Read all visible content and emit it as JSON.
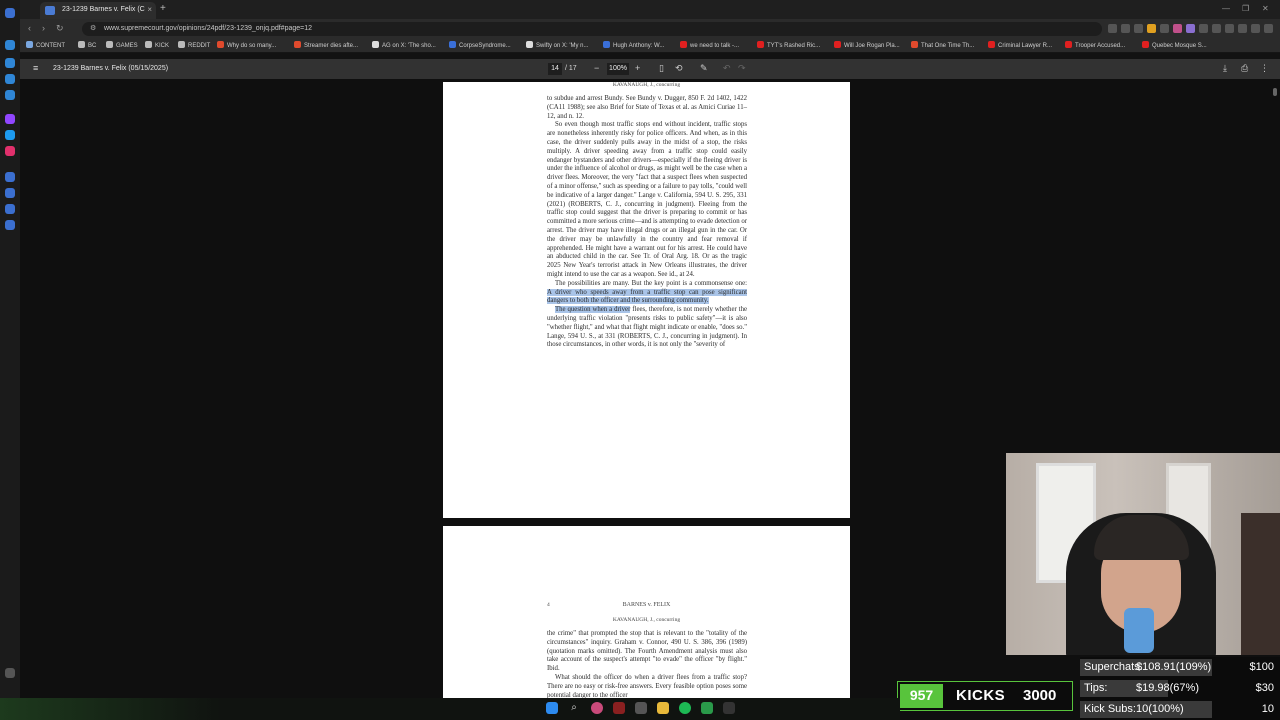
{
  "browser": {
    "tab_title": "23-1239 Barnes v. Felix (C",
    "tab_close": "×",
    "new_tab": "+",
    "url": "www.supremecourt.gov/opinions/24pdf/23-1239_onjq.pdf#page=12",
    "bookmarks": [
      {
        "label": "CONTENT",
        "color": "#7aa7e0"
      },
      {
        "label": "BC",
        "color": "#bbbbbb"
      },
      {
        "label": "GAMES",
        "color": "#bbbbbb"
      },
      {
        "label": "KICK",
        "color": "#bbbbbb"
      },
      {
        "label": "REDDIT",
        "color": "#bbbbbb"
      },
      {
        "label": "Why do so many...",
        "color": "#e04a2d"
      },
      {
        "label": "Streamer dies afte...",
        "color": "#e04a2d"
      },
      {
        "label": "AG on X: 'The sho...",
        "color": "#dddddd"
      },
      {
        "label": "CorpseSyndrome...",
        "color": "#3a6fd8"
      },
      {
        "label": "Swifty on X: 'My n...",
        "color": "#dddddd"
      },
      {
        "label": "Hugh Anthony: W...",
        "color": "#3a6fd8"
      },
      {
        "label": "we need to talk -...",
        "color": "#e02020"
      },
      {
        "label": "TYT's Rashed Ric...",
        "color": "#e02020"
      },
      {
        "label": "Will Joe Rogan Pla...",
        "color": "#e02020"
      },
      {
        "label": "That One Time Th...",
        "color": "#e04a2d"
      },
      {
        "label": "Criminal Lawyer R...",
        "color": "#e02020"
      },
      {
        "label": "Trooper Accused...",
        "color": "#e02020"
      },
      {
        "label": "Quebec Mosque S...",
        "color": "#e02020"
      }
    ]
  },
  "pdf": {
    "title": "23-1239 Barnes v. Felix (05/15/2025)",
    "current_page": "14",
    "total_pages": "/ 17",
    "zoom": "100%",
    "zoom_out": "−",
    "zoom_in": "+",
    "page1": {
      "running_head": "KAVANAUGH, J., concurring",
      "paragraphs": [
        {
          "pre": "to subdue and arrest Bundy.  See Bundy v. Dugger, 850 F. 2d 1402, 1422 (CA11 1988); see also Brief for State of Texas et al. as Amici Curiae 11–12, and n. 12.",
          "hl": "",
          "post": ""
        },
        {
          "pre": "So even though most traffic stops end without incident, traffic stops are nonetheless inherently risky for police officers.  And when, as in this case, the driver suddenly pulls away in the midst of a stop, the risks multiply.  A driver speeding away from a traffic stop could easily endanger bystanders and other drivers—especially if the fleeing driver is under the influence of alcohol or drugs, as might well be the case when a driver flees.  Moreover, the very \"fact that a suspect flees when suspected of a minor offense,\" such as speeding or a failure to pay tolls, \"could well be indicative of a larger danger.\"  Lange v. California, 594 U. S. 295, 331 (2021) (ROBERTS, C. J., concurring in judgment).  Fleeing from the traffic stop could suggest that the driver is preparing to commit or has committed a more serious crime—and is attempting to evade detection or arrest.  The driver may have illegal drugs or an illegal gun in the car.  Or the driver may be unlawfully in the country and fear removal if apprehended.  He might have a warrant out for his arrest.  He could have an abducted child in the car.  See Tr. of Oral Arg. 18.  Or as the tragic 2025 New Year's terrorist attack in New Orleans illustrates, the driver might intend to use the car as a weapon.  See id., at 24.",
          "hl": "",
          "post": ""
        },
        {
          "pre": "The possibilities are many.  But the key point is a commonsense one: ",
          "hl": "A driver who speeds away from a traffic stop can pose significant dangers to both the officer and the surrounding community.",
          "post": ""
        },
        {
          "pre": "",
          "hl": "The question when a driver",
          "post": " flees, therefore, is not merely whether the underlying traffic violation \"presents risks to public safety\"—it is also \"whether flight,\" and what that flight might indicate or enable, \"does so.\"  Lange, 594 U. S., at 331 (ROBERTS, C. J., concurring in judgment).  In those circumstances, in other words, it is not only the \"severity of"
        }
      ]
    },
    "page2": {
      "page_number": "4",
      "case_name": "BARNES v. FELIX",
      "running_head": "KAVANAUGH, J., concurring",
      "paragraphs": [
        {
          "text": "the crime\" that prompted the stop that is relevant to the \"totality of the circumstances\" inquiry.  Graham v. Connor, 490 U. S. 386, 396 (1989) (quotation marks omitted).  The Fourth Amendment analysis must also take account of the suspect's attempt \"to evade\" the officer \"by flight.\"  Ibid."
        },
        {
          "text": "What should the officer do when a driver flees from a traffic stop?  There are no easy or risk-free answers.  Every feasible option poses some potential danger to the officer"
        }
      ]
    }
  },
  "stream": {
    "kicks_count": "957",
    "kicks_label": "KICKS",
    "kicks_goal": "3000",
    "goals": [
      {
        "label": "Superchats:",
        "value": "$108.91(109%)",
        "target": "$100",
        "progress": 1.0
      },
      {
        "label": "Tips:",
        "value": "$19.98(67%)",
        "target": "$30",
        "progress": 0.67
      },
      {
        "label": "Kick Subs:",
        "value": "10(100%)",
        "target": "10",
        "progress": 1.0
      }
    ]
  }
}
